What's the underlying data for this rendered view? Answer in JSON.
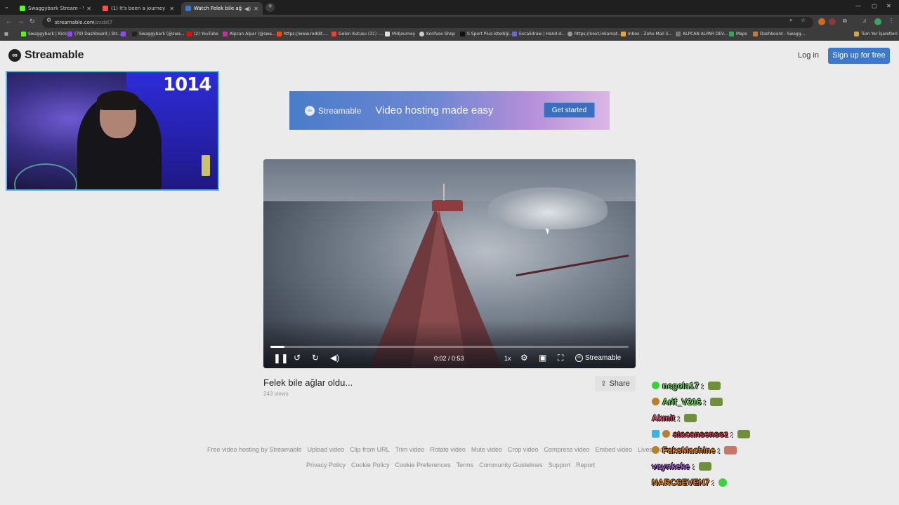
{
  "browser": {
    "tabs": [
      {
        "label": "Swaggybark Stream - Watch Liv",
        "fav_color": "#53fc18",
        "active": false
      },
      {
        "label": "(1) It's been a journey -",
        "fav_color": "#ff4d4d",
        "active": false
      },
      {
        "label": "Watch Felek bile ağlar oldu...",
        "fav_color": "#3d78c9",
        "active": true
      }
    ],
    "url_host": "streamable.com",
    "url_path": "/zxdst7",
    "bookmarks": [
      "Swaggybark | Kick",
      "(79) Dashboard / Str...",
      "",
      "Swaggybark (@swa...",
      "(2) YouTube",
      "Alpcan Alpar (@swa...",
      "https://www.reddit....",
      "Gelen Kutusu (31) -...",
      "Midjourney",
      "Konfuse Shop",
      "S Sport Plus-İstediği...",
      "Excalidraw | Hand-d...",
      "https://next.inkamat...",
      "Inbox - Zoho Mail (i...",
      "ALPCAN ALPAR DEV...",
      "Maps",
      "Dashboard - Swagg..."
    ],
    "bookmarks_other": "Tüm Yer İşaretleri"
  },
  "site": {
    "brand": "Streamable",
    "login": "Log in",
    "signup": "Sign up for free"
  },
  "banner": {
    "brand": "Streamable",
    "tagline": "Video hosting made easy",
    "cta": "Get started"
  },
  "player": {
    "time": "0:02 / 0:53",
    "speed": "1x",
    "brand": "Streamable",
    "progress": 0.04
  },
  "video": {
    "title": "Felek bile ağlar oldu...",
    "views": "243 views",
    "share": "Share"
  },
  "footer": {
    "row1": [
      "Free video hosting by Streamable",
      "Upload video",
      "Clip from URL",
      "Trim video",
      "Rotate video",
      "Mute video",
      "Crop video",
      "Compress video",
      "Embed video",
      "Livestream"
    ],
    "row2": [
      "Privacy Policy",
      "Cookie Policy",
      "Cookie Preferences",
      "Terms",
      "Community Guidelines",
      "Support",
      "Report"
    ]
  },
  "webcam": {
    "counter": "1014"
  },
  "chat": [
    {
      "user": "negola17",
      "color": "#7bd86b",
      "badge": "#3cd13c",
      "emote": "#6f8f3a"
    },
    {
      "user": "Arif_V216",
      "color": "#6bd84d",
      "badge": "#b87f2e",
      "emote": "#6f8f3a"
    },
    {
      "user": "Akmit",
      "color": "#e8577e",
      "badge": "",
      "emote": "#6f8f3a"
    },
    {
      "user": "atacansensoz",
      "color": "#e0344a",
      "badge": "#3fb2e0",
      "emote": "#6f8f3a"
    },
    {
      "user": "FaksMachine",
      "color": "#e88a1d",
      "badge": "#b87f2e",
      "emote": "#c7776a"
    },
    {
      "user": "vaynkeke",
      "color": "#a35ad8",
      "badge": "",
      "emote": "#6f8f3a"
    },
    {
      "user": "NARCSEVEN7",
      "color": "#e88a1d",
      "badge": "",
      "emote": "#3bd13b"
    }
  ]
}
